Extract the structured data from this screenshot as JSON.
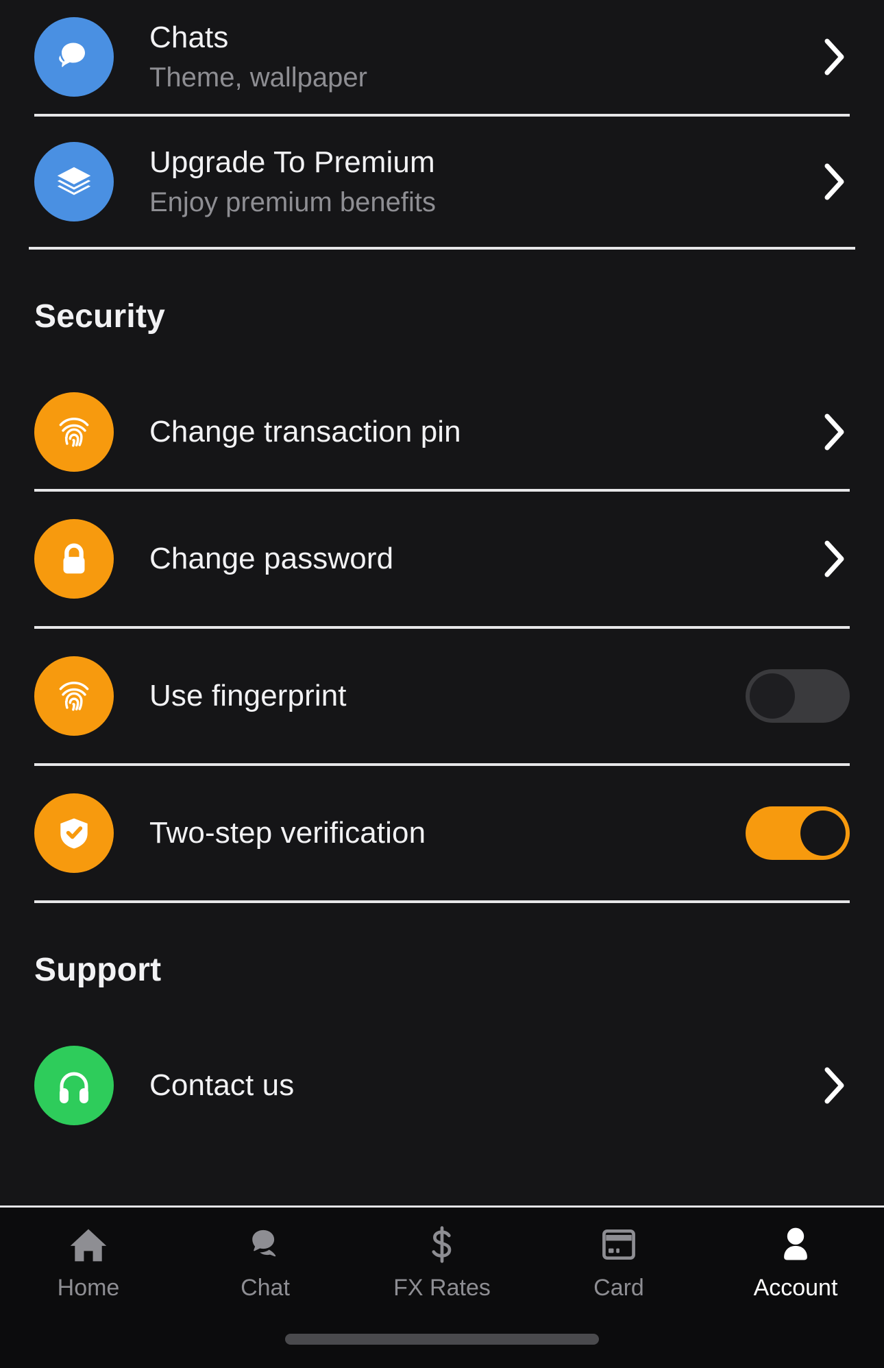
{
  "theme": {
    "background": "#151517",
    "divider": "#e6e6e8",
    "title_color": "#f2f2f4",
    "subtitle_color": "#8e8e93",
    "accent_orange": "#f79a0e",
    "accent_blue": "#4a90e2",
    "accent_green": "#2ecc5b",
    "toggle_off_track": "#3a3a3d",
    "tabbar_background": "#0c0c0d",
    "tab_inactive": "#8e8e93",
    "tab_active": "#ffffff"
  },
  "top_rows": [
    {
      "title": "Chats",
      "subtitle": "Theme, wallpaper",
      "icon": "chat-bubbles-icon",
      "icon_color": "#4a90e2",
      "accessory": "chevron-right-icon"
    },
    {
      "title": "Upgrade To Premium",
      "subtitle": "Enjoy premium benefits",
      "icon": "layers-icon",
      "icon_color": "#4a90e2",
      "accessory": "chevron-right-icon"
    }
  ],
  "security": {
    "heading": "Security",
    "rows": [
      {
        "title": "Change transaction pin",
        "icon": "fingerprint-icon",
        "icon_color": "#f79a0e",
        "accessory": "chevron-right-icon"
      },
      {
        "title": "Change password",
        "icon": "lock-icon",
        "icon_color": "#f79a0e",
        "accessory": "chevron-right-icon"
      },
      {
        "title": "Use fingerprint",
        "icon": "fingerprint-icon",
        "icon_color": "#f79a0e",
        "accessory": "toggle-switch",
        "toggle_state": "off"
      },
      {
        "title": "Two-step verification",
        "icon": "shield-check-icon",
        "icon_color": "#f79a0e",
        "accessory": "toggle-switch",
        "toggle_state": "on"
      }
    ]
  },
  "support": {
    "heading": "Support",
    "rows": [
      {
        "title": "Contact us",
        "icon": "headphones-icon",
        "icon_color": "#2ecc5b",
        "accessory": "chevron-right-icon"
      }
    ]
  },
  "tabbar": {
    "active_index": 4,
    "items": [
      {
        "label": "Home",
        "icon": "home-icon"
      },
      {
        "label": "Chat",
        "icon": "chat-bubbles-icon"
      },
      {
        "label": "FX Rates",
        "icon": "dollar-sign-icon"
      },
      {
        "label": "Card",
        "icon": "credit-card-icon"
      },
      {
        "label": "Account",
        "icon": "person-icon"
      }
    ]
  }
}
